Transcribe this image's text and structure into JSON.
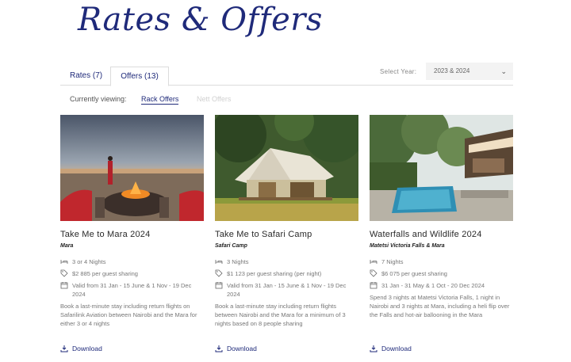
{
  "page": {
    "title": "Rates & Offers"
  },
  "tabs": [
    {
      "label": "Rates (7)"
    },
    {
      "label": "Offers (13)"
    }
  ],
  "year": {
    "label": "Select Year:",
    "value": "2023 & 2024"
  },
  "viewing": {
    "label": "Currently viewing:",
    "options": [
      "Rack Offers",
      "Nett Offers"
    ]
  },
  "cards": [
    {
      "title": "Take Me to Mara 2024",
      "location": "Mara",
      "nights": "3 or 4 Nights",
      "price": "$2 885 per guest sharing",
      "valid": "Valid from 31 Jan - 15 June & 1 Nov - 19 Dec 2024",
      "description": "Book a last-minute stay including return flights on Safarilink Aviation between Nairobi and the Mara for either 3 or 4 nights",
      "download": "Download"
    },
    {
      "title": "Take Me to Safari Camp",
      "location": "Safari Camp",
      "nights": "3 Nights",
      "price": "$1 123 per guest sharing (per night)",
      "valid": "Valid from 31 Jan - 15 June & 1 Nov - 19 Dec 2024",
      "description": "Book a last-minute stay including return flights between Nairobi and the Mara for a minimum of 3 nights based on 8 people sharing",
      "download": "Download"
    },
    {
      "title": "Waterfalls and Wildlife 2024",
      "location": "Matetsi Victoria Falls & Mara",
      "nights": "7 Nights",
      "price": "$6 075 per guest sharing",
      "valid": "31 Jan - 31 May & 1 Oct - 20 Dec 2024",
      "description": "Spend 3 nights at Matetsi Victoria Falls, 1 night in Nairobi and 3 nights at Mara, including a heli flip over the Falls and hot-air ballooning in the Mara",
      "download": "Download"
    }
  ],
  "icons": {
    "nights": "bed-icon",
    "price": "tag-icon",
    "valid": "calendar-icon",
    "download": "download-icon",
    "select": "chevron-down-icon"
  }
}
